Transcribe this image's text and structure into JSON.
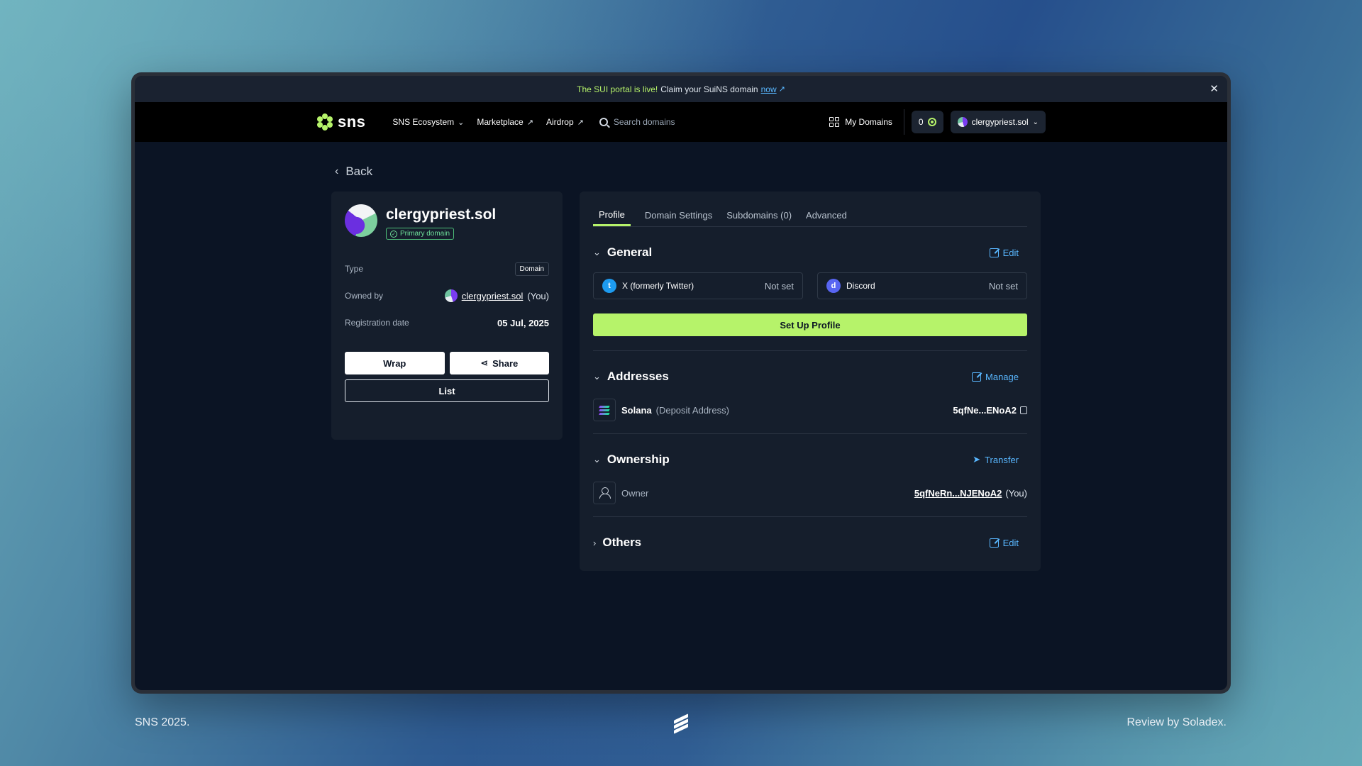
{
  "announcement": {
    "highlight": "The SUI portal is live!",
    "text": "Claim your SuiNS domain",
    "link": "now"
  },
  "nav": {
    "logo": "sns",
    "links": [
      {
        "label": "SNS Ecosystem",
        "suffix": "⌄"
      },
      {
        "label": "Marketplace",
        "suffix": "↗"
      },
      {
        "label": "Airdrop",
        "suffix": "↗"
      }
    ],
    "search_placeholder": "Search domains",
    "my_domains": "My Domains",
    "points": "0",
    "account": "clergypriest.sol"
  },
  "back_label": "Back",
  "domain_card": {
    "name": "clergypriest.sol",
    "primary_badge": "Primary domain",
    "type_label": "Type",
    "type_value": "Domain",
    "owned_by_label": "Owned by",
    "owned_by_value": "clergypriest.sol",
    "owned_by_suffix": "(You)",
    "reg_label": "Registration date",
    "reg_value": "05 Jul, 2025",
    "wrap": "Wrap",
    "share": "Share",
    "list": "List"
  },
  "tabs": [
    "Profile",
    "Domain Settings",
    "Subdomains (0)",
    "Advanced"
  ],
  "general": {
    "title": "General",
    "action": "Edit",
    "twitter_label": "X (formerly Twitter)",
    "twitter_value": "Not set",
    "discord_label": "Discord",
    "discord_value": "Not set",
    "setup_button": "Set Up Profile"
  },
  "addresses": {
    "title": "Addresses",
    "action": "Manage",
    "chain": "Solana",
    "note": "(Deposit Address)",
    "address": "5qfNe...ENoA2"
  },
  "ownership": {
    "title": "Ownership",
    "action": "Transfer",
    "owner_label": "Owner",
    "owner_address": "5qfNeRn...NJENoA2",
    "owner_suffix": "(You)"
  },
  "others": {
    "title": "Others",
    "action": "Edit"
  },
  "footer": {
    "left": "SNS 2025.",
    "right": "Review by Soladex."
  },
  "colors": {
    "accent_green": "#b6f36a",
    "link_blue": "#59b7ff",
    "panel": "#151e2c",
    "background": "#0b1424"
  }
}
